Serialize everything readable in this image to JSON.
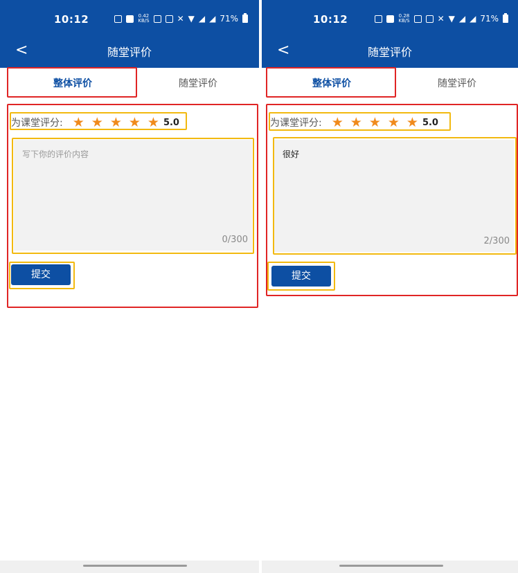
{
  "status": {
    "time": "10:12",
    "speed_left": "0.42",
    "speed_right": "0.28",
    "speed_unit": "KB/S",
    "network": "4G",
    "battery": "71%"
  },
  "nav": {
    "back_glyph": "<",
    "title": "随堂评价"
  },
  "tabs": [
    "整体评价",
    "随堂评价"
  ],
  "rating": {
    "label": "为课堂评分:",
    "stars": 5,
    "star_glyph": "★",
    "value": "5.0"
  },
  "left_screen": {
    "textarea_placeholder": "写下你的评价内容",
    "textarea_value": "",
    "counter": "0/300"
  },
  "right_screen": {
    "textarea_placeholder": "写下你的评价内容",
    "textarea_value": "很好",
    "counter": "2/300"
  },
  "submit_label": "提交",
  "colors": {
    "brand": "#0d4fa3",
    "star": "#f08a1c",
    "highlight_red": "#e02424",
    "highlight_yellow": "#f2b90f"
  }
}
